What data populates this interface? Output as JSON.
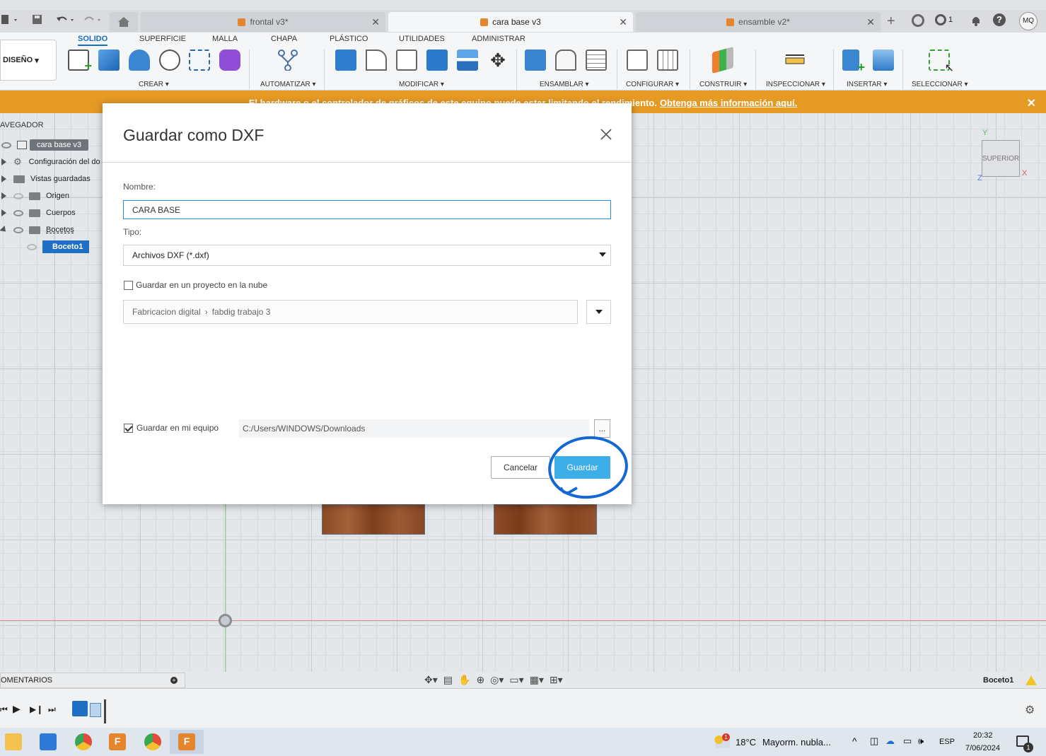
{
  "doc_tabs": [
    {
      "label": "frontal v3*"
    },
    {
      "label": "cara base v3"
    },
    {
      "label": "ensamble v2*"
    }
  ],
  "header_right": {
    "jobs_count": "1",
    "user_initials": "MQ"
  },
  "ribbon": {
    "workspace": "DISEÑO",
    "tabs": [
      "SOLIDO",
      "SUPERFICIE",
      "MALLA",
      "CHAPA",
      "PLÁSTICO",
      "UTILIDADES",
      "ADMINISTRAR"
    ],
    "groups": [
      "CREAR",
      "AUTOMATIZAR",
      "MODIFICAR",
      "ENSAMBLAR",
      "CONFIGURAR",
      "CONSTRUIR",
      "INSPECCIONAR",
      "INSERTAR",
      "SELECCIONAR"
    ]
  },
  "warning": {
    "text": "El hardware o el controlador de gráficos de este equipo puede estar limitando el rendimiento.",
    "link": "Obtenga más información aquí."
  },
  "browser": {
    "title": "AVEGADOR",
    "root": "cara base v3",
    "items": [
      "Configuración del do",
      "Vistas guardadas",
      "Origen",
      "Cuerpos",
      "Bocetos",
      "Boceto1"
    ]
  },
  "viewcube": {
    "face": "SUPERIOR",
    "axis_x": "X",
    "axis_y": "Y",
    "axis_z": "Z"
  },
  "dialog": {
    "title": "Guardar como DXF",
    "name_label": "Nombre:",
    "name_value": "CARA BASE",
    "type_label": "Tipo:",
    "type_value": "Archivos DXF (*.dxf)",
    "cloud_label": "Guardar en un proyecto en la nube",
    "cloud_checked": false,
    "cloud_path_project": "Fabricacion digital",
    "cloud_path_folder": "fabdig trabajo 3",
    "local_label": "Guardar en mi equipo",
    "local_checked": true,
    "local_path": "C:/Users/WINDOWS/Downloads",
    "browse_label": "...",
    "cancel_label": "Cancelar",
    "save_label": "Guardar",
    "save_color": "#3eaee8"
  },
  "comments": {
    "label": "OMENTARIOS"
  },
  "status": {
    "active_sketch": "Boceto1"
  },
  "taskbar": {
    "weather_temp": "18°C",
    "weather_text": "Mayorm. nubla...",
    "weather_badge": "1",
    "lang": "ESP",
    "time": "20:32",
    "date": "7/06/2024",
    "notif_count": "1"
  },
  "colors": {
    "accent": "#1a6fc0",
    "warning": "#e59a23",
    "annotation": "#1468d6"
  }
}
